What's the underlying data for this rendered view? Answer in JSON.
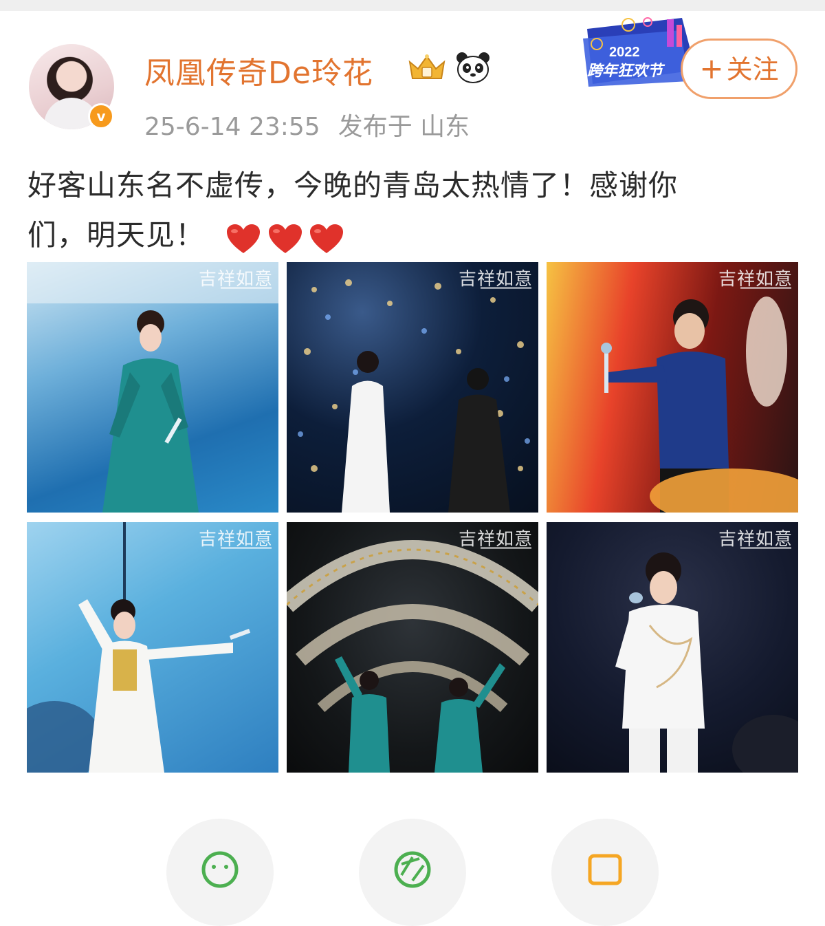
{
  "post": {
    "username": "凤凰传奇De玲花",
    "verified_badge": "v",
    "timestamp": "25-6-14 23:55",
    "location": "发布于 山东",
    "follow_label": "关注",
    "follow_plus": "+",
    "text_line1": "好客山东名不虚传，今晚的青岛太热情了！感谢你",
    "text_line2": "们，明天见！",
    "heart_count": 3
  },
  "event_badge": {
    "year": "2022",
    "name": "跨年狂欢节"
  },
  "photos": [
    {
      "watermark": "吉祥如意",
      "alt": "女歌手身穿青绿色礼服手持麦克风"
    },
    {
      "watermark": "吉祥如意",
      "alt": "两位歌手背对舞台面对灯海"
    },
    {
      "watermark": "吉祥如意",
      "alt": "男歌手身穿星空外套手持麦克风"
    },
    {
      "watermark": "吉祥如意",
      "alt": "女歌手白色长裙张开双臂"
    },
    {
      "watermark": "吉祥如意",
      "alt": "两位歌手身穿青绿色服装在拱门下挥手"
    },
    {
      "watermark": "吉祥如意",
      "alt": "男歌手身穿白色刺绣西装演唱"
    }
  ],
  "actions": [
    {
      "icon": "emoji-icon",
      "color": "#4caf50"
    },
    {
      "icon": "camera-aperture-icon",
      "color": "#4caf50"
    },
    {
      "icon": "image-icon",
      "color": "#f5a623"
    }
  ],
  "colors": {
    "username": "#e2742f",
    "meta": "#9a9a9a",
    "follow_border": "#f0a06b",
    "heart": "#e0322b"
  }
}
